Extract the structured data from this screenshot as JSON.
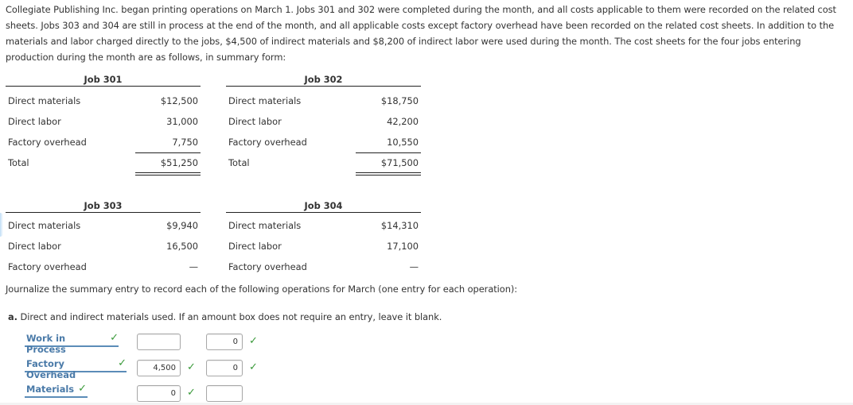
{
  "intro": "Collegiate Publishing Inc. began printing operations on March 1. Jobs 301 and 302 were completed during the month, and all costs applicable to them were recorded on the related cost sheets. Jobs 303 and 304 are still in process at the end of the month, and all applicable costs except factory overhead have been recorded on the related cost sheets. In addition to the materials and labor charged directly to the jobs, $4,500 of indirect materials and $8,200 of indirect labor were used during the month. The cost sheets for the four jobs entering production during the month are as follows, in summary form:",
  "jobs": [
    {
      "title": "Job 301",
      "rows": [
        {
          "label": "Direct materials",
          "value": "$12,500"
        },
        {
          "label": "Direct labor",
          "value": "31,000"
        },
        {
          "label": "Factory overhead",
          "value": "7,750"
        }
      ],
      "total": {
        "label": "Total",
        "value": "$51,250"
      }
    },
    {
      "title": "Job 302",
      "rows": [
        {
          "label": "Direct materials",
          "value": "$18,750"
        },
        {
          "label": "Direct labor",
          "value": "42,200"
        },
        {
          "label": "Factory overhead",
          "value": "10,550"
        }
      ],
      "total": {
        "label": "Total",
        "value": "$71,500"
      }
    },
    {
      "title": "Job 303",
      "rows": [
        {
          "label": "Direct materials",
          "value": "$9,940"
        },
        {
          "label": "Direct labor",
          "value": "16,500"
        },
        {
          "label": "Factory overhead",
          "value": "—"
        }
      ]
    },
    {
      "title": "Job 304",
      "rows": [
        {
          "label": "Direct materials",
          "value": "$14,310"
        },
        {
          "label": "Direct labor",
          "value": "17,100"
        },
        {
          "label": "Factory overhead",
          "value": "—"
        }
      ]
    }
  ],
  "journalize_prompt": "Journalize the summary entry to record each of the following operations for March (one entry for each operation):",
  "part_a": {
    "letter": "a.",
    "text": "Direct and indirect materials used. If an amount box does not require an entry, leave it blank.",
    "entries": [
      {
        "account": "Work in Process",
        "account_check": "✓",
        "debit": "",
        "debit_check": "",
        "credit": "0",
        "credit_check": "✓"
      },
      {
        "account": "Factory Overhead",
        "account_check": "✓",
        "debit": "4,500",
        "debit_check": "✓",
        "credit": "0",
        "credit_check": "✓"
      },
      {
        "account": "Materials",
        "account_check": "✓",
        "debit": "0",
        "debit_check": "✓",
        "credit": "",
        "credit_check": ""
      }
    ]
  },
  "colors": {
    "account_link": "#4a7aa8",
    "check": "#3a9a3a"
  }
}
